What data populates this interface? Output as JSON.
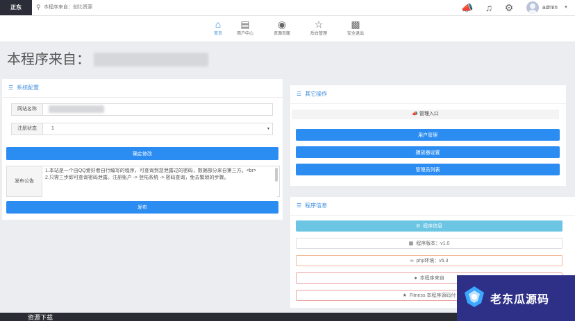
{
  "topbar": {
    "brand": "正东",
    "search_placeholder": "本程序来自：创比资源",
    "icons": [
      "megaphone-icon",
      "music-icon",
      "gear-icon"
    ],
    "username": "admin"
  },
  "nav": {
    "items": [
      {
        "label": "首页",
        "icon": "home-icon",
        "active": true
      },
      {
        "label": "用户中心",
        "icon": "user-center-icon"
      },
      {
        "label": "资源页面",
        "icon": "camera-icon"
      },
      {
        "label": "后台管理",
        "icon": "star-icon"
      },
      {
        "label": "安全退出",
        "icon": "bars-icon"
      }
    ]
  },
  "page_title": "本程序来自：",
  "config_panel": {
    "title": "系统配置",
    "site_name_label": "网站名称",
    "register_label": "注册状态",
    "register_value": "1",
    "confirm_button": "确定修改",
    "notice_label": "发布公告",
    "notice_text": "1.本站是一个由QQ爱好者自行编写的程序，可查询到您泄露过的密码，数据部分来自第三方。<br>\n2.只需三步即可查询密码泄露。注册账户 -> 登陆系统 -> 密码查询，免去繁琐的步骤。",
    "publish_button": "发布"
  },
  "other_panel": {
    "title": "其它操作",
    "admin_entry": "管理入口",
    "buttons": [
      "用户管理",
      "播放器设置",
      "管理员列表"
    ]
  },
  "program_panel": {
    "title": "程序信息",
    "header": "程序信息",
    "rows": [
      {
        "label": "程序版本：v1.0",
        "style": "default"
      },
      {
        "label": "php环境：v5.3",
        "style": "orange"
      },
      {
        "label": "本程序来自",
        "style": "red"
      },
      {
        "label": "Fitness 本程序源码付",
        "style": "red"
      }
    ]
  },
  "watermark": {
    "text": "老东瓜源码"
  },
  "footer": {
    "text": "资源下载"
  },
  "colors": {
    "primary": "#2b8cf2",
    "info": "#6cc5e3",
    "brand_bg": "#2b2e38",
    "watermark_bg": "#2e2f87"
  }
}
